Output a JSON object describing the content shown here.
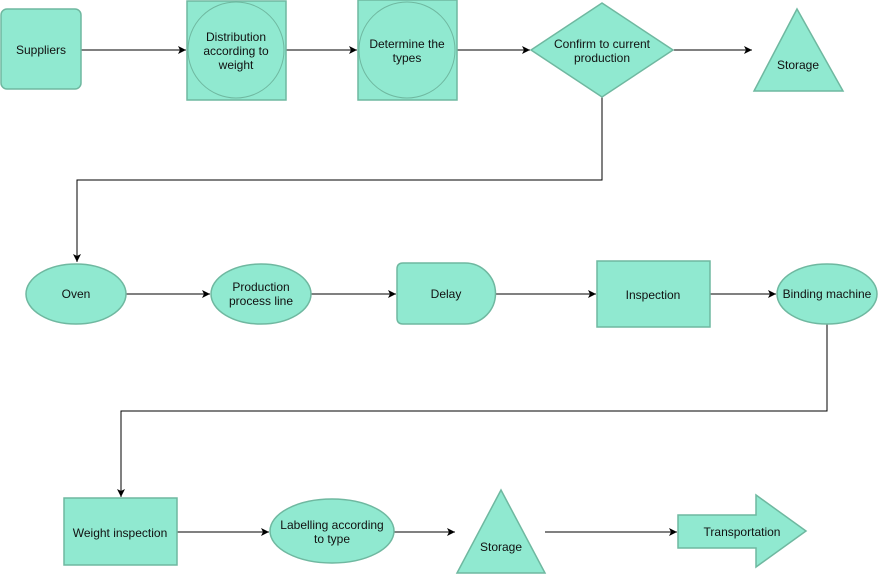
{
  "colors": {
    "fill": "#90e9d0",
    "stroke": "#6fb8a0",
    "connector": "#000000"
  },
  "nodes": {
    "suppliers": "Suppliers",
    "distribution": [
      "Distribution",
      "according to",
      "weight"
    ],
    "determine": [
      "Determine the",
      "types"
    ],
    "confirm": [
      "Confirm to current",
      "production"
    ],
    "storage1": "Storage",
    "oven": "Oven",
    "production": [
      "Production",
      "process line"
    ],
    "delay": "Delay",
    "inspection": "Inspection",
    "binding": "Binding machine",
    "weight": "Weight inspection",
    "labelling": [
      "Labelling according",
      "to type"
    ],
    "storage2": "Storage",
    "transportation": "Transportation"
  }
}
